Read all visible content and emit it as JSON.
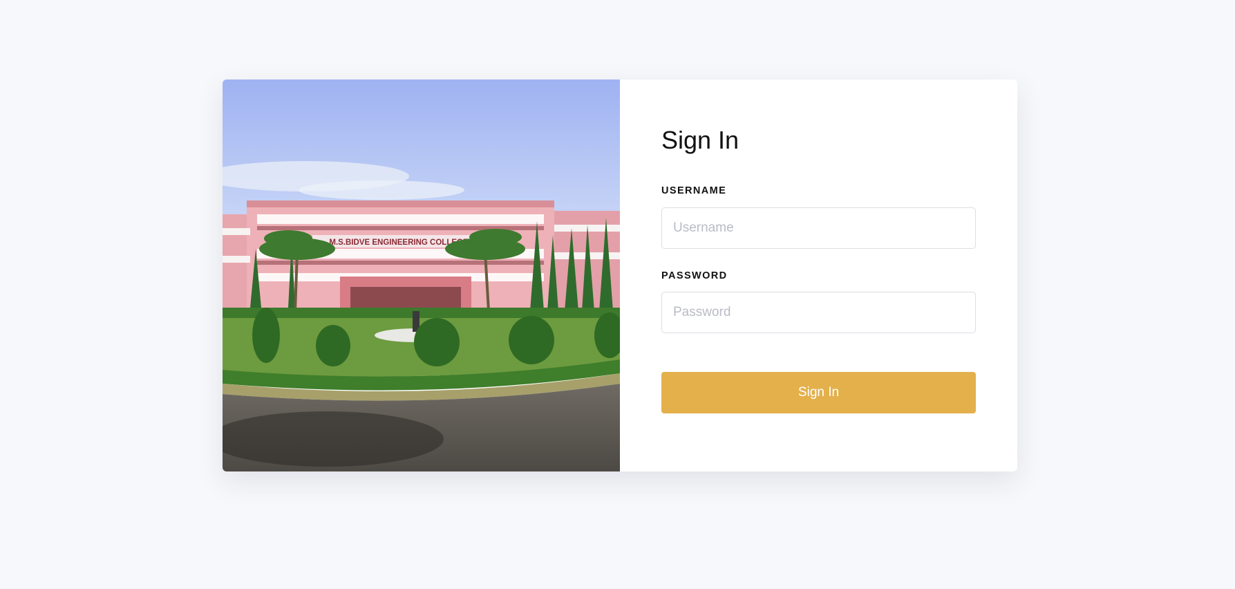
{
  "login": {
    "title": "Sign In",
    "username": {
      "label": "USERNAME",
      "placeholder": "Username",
      "value": ""
    },
    "password": {
      "label": "PASSWORD",
      "placeholder": "Password",
      "value": ""
    },
    "submit_label": "Sign In"
  },
  "photo": {
    "building_sign": "M.S.BIDVE ENGINEERING COLLEGE"
  },
  "colors": {
    "page_background": "#f7f8fb",
    "card_background": "#ffffff",
    "button": "#e3b04b",
    "button_text": "#ffffff",
    "text": "#111111",
    "placeholder": "#b9bcc4",
    "input_border": "#dcdde3"
  }
}
